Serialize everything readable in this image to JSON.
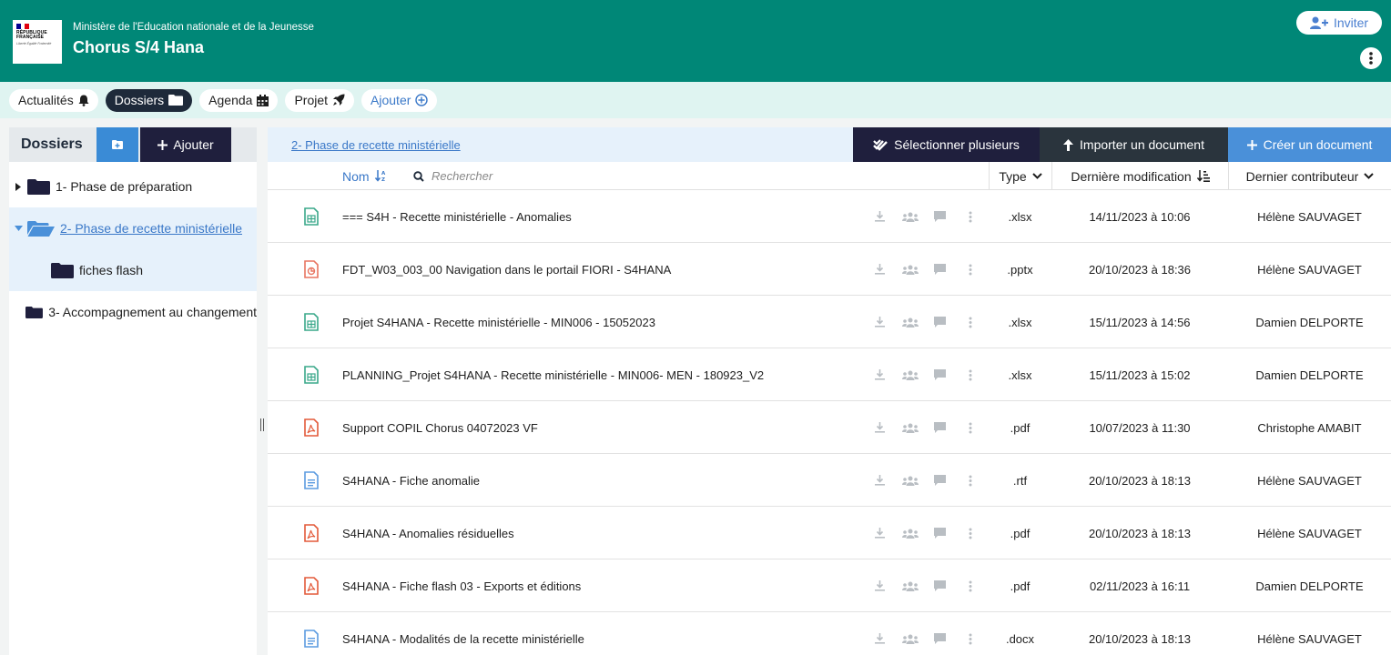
{
  "header": {
    "logo": {
      "line1": "RÉPUBLIQUE",
      "line2": "FRANÇAISE",
      "motto": "Liberté Égalité Fraternité"
    },
    "ministry": "Ministère de l'Education nationale et de la Jeunesse",
    "title": "Chorus S/4 Hana",
    "invite_label": "Inviter"
  },
  "tabs": [
    {
      "label": "Actualités",
      "icon": "bell-icon"
    },
    {
      "label": "Dossiers",
      "icon": "folder-icon",
      "active": true
    },
    {
      "label": "Agenda",
      "icon": "calendar-icon"
    },
    {
      "label": "Projet",
      "icon": "rocket-icon"
    },
    {
      "label": "Ajouter",
      "icon": "plus-circle-icon"
    }
  ],
  "sidebar": {
    "title": "Dossiers",
    "add_label": "Ajouter",
    "tree": [
      {
        "label": "1- Phase de préparation",
        "expanded": false,
        "level": 0
      },
      {
        "label": "2- Phase de recette ministérielle",
        "expanded": true,
        "selected": true,
        "level": 0
      },
      {
        "label": "fiches flash",
        "level": 1
      },
      {
        "label": "3- Accompagnement au changement",
        "level": 0
      }
    ]
  },
  "main": {
    "breadcrumb": "2- Phase de recette ministérielle",
    "buttons": {
      "select_multiple": "Sélectionner plusieurs",
      "import": "Importer un document",
      "create": "Créer un document"
    },
    "columns": {
      "name": "Nom",
      "search_placeholder": "Rechercher",
      "type": "Type",
      "modified": "Dernière modification",
      "contributor": "Dernier contributeur"
    },
    "files": [
      {
        "name": "=== S4H - Recette ministérielle - Anomalies",
        "type": ".xlsx",
        "icon": "spreadsheet-icon",
        "modified": "14/11/2023 à 10:06",
        "author": "Hélène SAUVAGET"
      },
      {
        "name": "FDT_W03_003_00 Navigation dans le portail FIORI - S4HANA",
        "type": ".pptx",
        "icon": "presentation-icon",
        "modified": "20/10/2023 à 18:36",
        "author": "Hélène SAUVAGET"
      },
      {
        "name": "Projet S4HANA - Recette ministérielle - MIN006 - 15052023",
        "type": ".xlsx",
        "icon": "spreadsheet-icon",
        "modified": "15/11/2023 à 14:56",
        "author": "Damien DELPORTE"
      },
      {
        "name": "PLANNING_Projet S4HANA - Recette ministérielle - MIN006- MEN - 180923_V2",
        "type": ".xlsx",
        "icon": "spreadsheet-icon",
        "modified": "15/11/2023 à 15:02",
        "author": "Damien DELPORTE"
      },
      {
        "name": "Support COPIL Chorus 04072023 VF",
        "type": ".pdf",
        "icon": "pdf-icon",
        "modified": "10/07/2023 à 11:30",
        "author": "Christophe AMABIT"
      },
      {
        "name": "S4HANA - Fiche anomalie",
        "type": ".rtf",
        "icon": "text-doc-icon",
        "modified": "20/10/2023 à 18:13",
        "author": "Hélène SAUVAGET"
      },
      {
        "name": "S4HANA - Anomalies résiduelles",
        "type": ".pdf",
        "icon": "pdf-icon",
        "modified": "20/10/2023 à 18:13",
        "author": "Hélène SAUVAGET"
      },
      {
        "name": "S4HANA - Fiche flash 03 - Exports et éditions",
        "type": ".pdf",
        "icon": "pdf-icon",
        "modified": "02/11/2023 à 16:11",
        "author": "Damien DELPORTE"
      },
      {
        "name": "S4HANA - Modalités de la recette ministérielle",
        "type": ".docx",
        "icon": "text-doc-icon",
        "modified": "20/10/2023 à 18:13",
        "author": "Hélène SAUVAGET"
      }
    ]
  },
  "colors": {
    "header_bg": "#008777",
    "tabs_bg": "#dff4f1",
    "dark_button": "#1f1f3d",
    "accent_blue": "#4a90d9",
    "link": "#3a78c8",
    "xlsx_icon": "#3aa88a",
    "pptx_icon": "#e87561",
    "pdf_icon": "#e35a3a",
    "doc_icon": "#5b9be0"
  }
}
